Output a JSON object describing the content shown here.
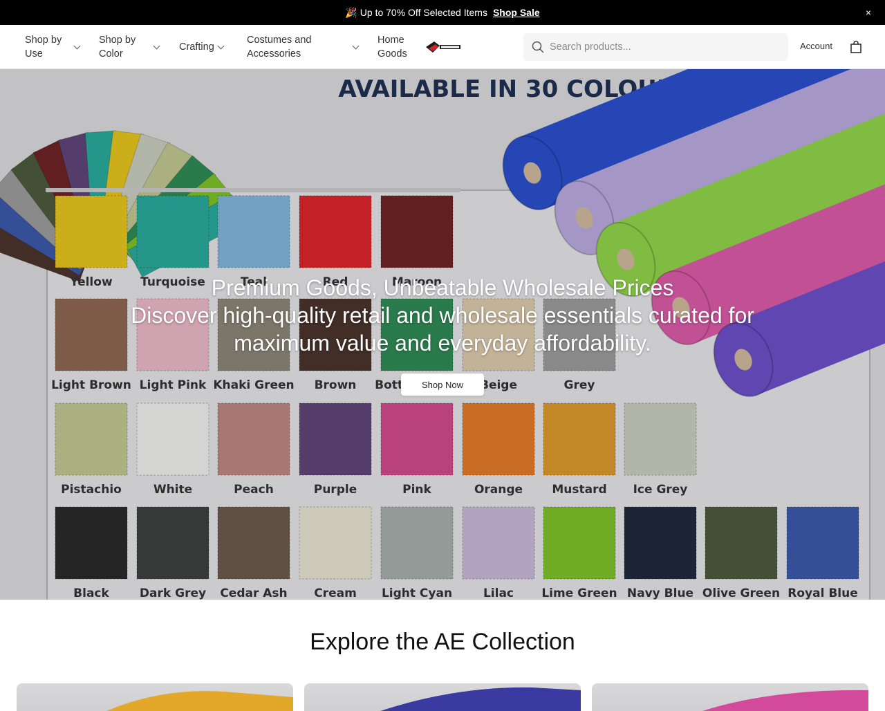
{
  "announcement": {
    "emoji": "🎉",
    "message": "Up to 70% Off Selected Items",
    "link": "Shop Sale",
    "close": "×"
  },
  "nav": {
    "items": [
      {
        "label": "Shop by Use",
        "has_dropdown": true
      },
      {
        "label": "Shop by Color",
        "has_dropdown": true
      },
      {
        "label": "Crafting",
        "has_dropdown": true
      },
      {
        "label": "Costumes and Accessories",
        "has_dropdown": true
      },
      {
        "label": "Home Goods",
        "has_dropdown": false
      }
    ],
    "logo_icon": "ae-market-logo",
    "search_placeholder": "Search products...",
    "account_label": "Account",
    "cart_icon": "shopping-bag-icon"
  },
  "hero": {
    "title": "Premium Goods, Unbeatable Wholesale Prices",
    "subtitle": "Discover high-quality retail and wholesale essentials curated for maximum value and everyday affordability.",
    "button_label": "Shop Now",
    "image_heading": "AVAILABLE IN 30 COLOURS",
    "swatches": [
      {
        "name": "Yellow",
        "color": "#e3c21c"
      },
      {
        "name": "Turquoise",
        "color": "#2aa99a"
      },
      {
        "name": "Teal",
        "color": "#7fb4d9"
      },
      {
        "name": "Red",
        "color": "#d9262a"
      },
      {
        "name": "Maroon",
        "color": "#6e2326"
      },
      {
        "name": "Light Brown",
        "color": "#8d6652"
      },
      {
        "name": "Light Pink",
        "color": "#e8b6c4"
      },
      {
        "name": "Khaki Green",
        "color": "#8a8475"
      },
      {
        "name": "Brown",
        "color": "#4a342b"
      },
      {
        "name": "Bottle Green",
        "color": "#2e8a55"
      },
      {
        "name": "Beige",
        "color": "#d8c7a9"
      },
      {
        "name": "Grey",
        "color": "#9a9a9a"
      },
      {
        "name": "Pistachio",
        "color": "#bfc48f"
      },
      {
        "name": "White",
        "color": "#ececea"
      },
      {
        "name": "Peach",
        "color": "#b98580"
      },
      {
        "name": "Purple",
        "color": "#5f4478"
      },
      {
        "name": "Pink",
        "color": "#cf4a8a"
      },
      {
        "name": "Orange",
        "color": "#e07a2a"
      },
      {
        "name": "Mustard",
        "color": "#d9982d"
      },
      {
        "name": "Ice Grey",
        "color": "#c7cbbb"
      },
      {
        "name": "Black",
        "color": "#2a2a2a"
      },
      {
        "name": "Dark Grey",
        "color": "#3d4140"
      },
      {
        "name": "Cedar Ash",
        "color": "#6b5a4c"
      },
      {
        "name": "Cream",
        "color": "#e5e1d0"
      },
      {
        "name": "Light Cyan",
        "color": "#a4aeaa"
      },
      {
        "name": "Lilac",
        "color": "#c9b6d6"
      },
      {
        "name": "Lime Green",
        "color": "#7dbf2a"
      },
      {
        "name": "Navy Blue",
        "color": "#1f2a3d"
      },
      {
        "name": "Olive Green",
        "color": "#4b5a3c"
      },
      {
        "name": "Royal Blue",
        "color": "#3b58a8"
      }
    ],
    "rolls": [
      "#2a4fc9",
      "#b7a9dd",
      "#8fd24a",
      "#d85aa6",
      "#6a4fc6"
    ]
  },
  "collection": {
    "title": "Explore the AE Collection",
    "cards": [
      {
        "accent": "#e3a72a"
      },
      {
        "accent": "#3a3aa0"
      },
      {
        "accent": "#d44a9a"
      }
    ]
  }
}
